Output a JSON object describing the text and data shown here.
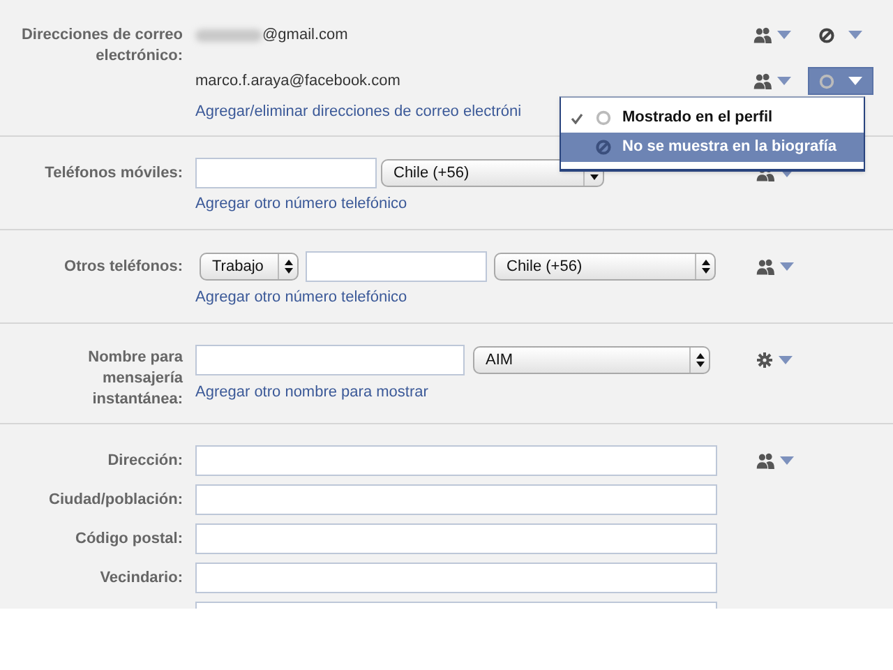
{
  "sections": [
    {
      "kind": "emails",
      "label": "Direcciones de correo electrónico:",
      "emails": [
        {
          "address": "@gmail.com",
          "redacted": true,
          "audience": {
            "kind": "friends"
          },
          "visibility": {
            "kind": "hidden"
          },
          "open": false
        },
        {
          "address": "marco.f.araya@facebook.com",
          "redacted": false,
          "audience": {
            "kind": "friends"
          },
          "visibility": {
            "kind": "shown"
          },
          "open": true
        }
      ],
      "link": "Agregar/eliminar direcciones de correo electróni"
    },
    {
      "kind": "phone",
      "label": "Teléfonos móviles:",
      "country": "Chile (+56)",
      "link": "Agregar otro número telefónico",
      "audience": {
        "kind": "friends"
      }
    },
    {
      "kind": "phone",
      "label": "Otros teléfonos:",
      "phone_type": "Trabajo",
      "country": "Chile (+56)",
      "link": "Agregar otro número telefónico",
      "audience": {
        "kind": "friends"
      }
    },
    {
      "kind": "im",
      "label": "Nombre para mensajería instantánea:",
      "service": "AIM",
      "link": "Agregar otro nombre para mostrar",
      "audience": {
        "kind": "custom"
      }
    },
    {
      "kind": "address",
      "audience": {
        "kind": "friends"
      },
      "fields": [
        {
          "kind": "labeled",
          "label": "Dirección:"
        },
        {
          "kind": "labeled",
          "label": "Ciudad/población:"
        },
        {
          "kind": "labeled",
          "label": "Código postal:"
        },
        {
          "kind": "labeled",
          "label": "Vecindario:"
        },
        {
          "kind": "unlabeled"
        }
      ]
    }
  ],
  "menu": {
    "items": [
      {
        "kind": "shown",
        "label": "Mostrado en el perfil",
        "checked": true,
        "highlighted": false
      },
      {
        "kind": "hidden",
        "label": "No se muestra en la biografía",
        "checked": false,
        "highlighted": true
      }
    ]
  }
}
